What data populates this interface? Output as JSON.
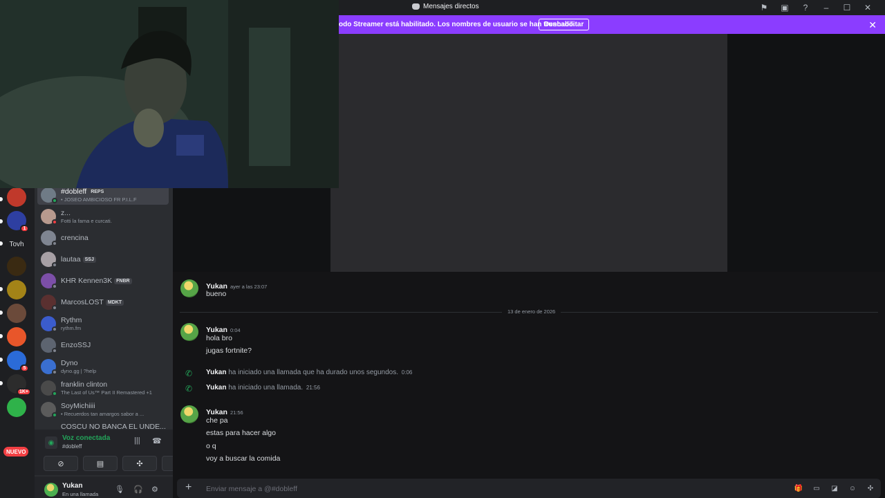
{
  "window": {
    "title": "Mensajes directos"
  },
  "banner": {
    "text": "odo Streamer está habilitado. Los nombres de usuario se han truncado.",
    "button": "Deshabilitar",
    "color": "#8b3dff"
  },
  "rail": {
    "servers": [
      {
        "label": "",
        "color": "#c0392b"
      },
      {
        "label": "",
        "color": "#2e3fa1",
        "badge": "1"
      },
      {
        "label": "Tovh",
        "color": "#1e1f22"
      },
      {
        "label": "",
        "color": "#3a2a12"
      },
      {
        "label": "",
        "color": "#a38317"
      },
      {
        "label": "",
        "color": "#6b4a3a"
      },
      {
        "label": "",
        "color": "#e8562a"
      },
      {
        "label": "",
        "color": "#2b6bd8",
        "badge": "5"
      },
      {
        "label": "",
        "color": "#2c2c2c",
        "badge": "1K+"
      },
      {
        "label": "",
        "color": "#2fb24a"
      }
    ],
    "nuevo": "NUEVO"
  },
  "dms": [
    {
      "name": "#dobleff",
      "tag": "REPS",
      "sub": "• JOSEO AMBICIOSO FR P.I.L.F",
      "status": "#23a55a",
      "active": true,
      "avatar": "#6f7b86"
    },
    {
      "name": "z...",
      "tag": "",
      "sub": "Fotti la fama e curcati.",
      "status": "#f23f43",
      "active": false,
      "avatar": "#b89a8e"
    },
    {
      "name": "crencina",
      "tag": "",
      "sub": "",
      "status": "#80848e",
      "active": false,
      "avatar": "#7f8591"
    },
    {
      "name": "lautaa",
      "tag": "SSJ",
      "sub": "",
      "status": "#80848e",
      "active": false,
      "avatar": "#a7a0a5"
    },
    {
      "name": "KHR Kennen3K",
      "tag": "FNBR",
      "sub": "",
      "status": "#80848e",
      "active": false,
      "avatar": "#7c4fa8"
    },
    {
      "name": "MarcosLOST",
      "tag": "MDKT",
      "sub": "",
      "status": "#80848e",
      "active": false,
      "avatar": "#5a3030"
    },
    {
      "name": "Rythm",
      "tag": "",
      "sub": "rythm.fm",
      "status": "#80848e",
      "active": false,
      "avatar": "#3b5ccc"
    },
    {
      "name": "EnzoSSJ",
      "tag": "",
      "sub": "",
      "status": "#80848e",
      "active": false,
      "avatar": "#5d6470"
    },
    {
      "name": "Dyno",
      "tag": "",
      "sub": "dyno.gg | ?help",
      "status": "#80848e",
      "active": false,
      "avatar": "#3a6fd0"
    },
    {
      "name": "franklin clinton",
      "tag": "",
      "sub": "The Last of Us™ Part II Remastered +1",
      "status": "#23a55a",
      "active": false,
      "avatar": "#4a4a4a"
    },
    {
      "name": "SoyMichiiii",
      "tag": "",
      "sub": "• Recuerdos tan amargos sabor a ...",
      "status": "#23a55a",
      "active": false,
      "avatar": "#5b5b5b"
    },
    {
      "name": "COSCU NO BANCA EL UNDE...",
      "tag": "",
      "sub": "",
      "status": "#80848e",
      "active": false,
      "avatar": "#333"
    }
  ],
  "voice": {
    "status": "Voz conectada",
    "channel": "#dobleff"
  },
  "user": {
    "name": "Yukan",
    "status": "En una llamada"
  },
  "chat": {
    "messages": [
      {
        "author": "Yukan",
        "time": "ayer a las 23:07",
        "lines": [
          "bueno"
        ]
      },
      {
        "author": "Yukan",
        "time": "0:04",
        "lines": [
          "hola bro",
          "jugas fortnite?"
        ]
      },
      {
        "author": "Yukan",
        "time": "21:56",
        "lines": [
          "che pa",
          "estas para hacer algo",
          "o q",
          "voy a buscar la comida"
        ]
      }
    ],
    "date_divider": "13 de enero de 2026",
    "calls": [
      {
        "author": "Yukan",
        "text": "ha iniciado una llamada que ha durado unos segundos.",
        "time": "0:06"
      },
      {
        "author": "Yukan",
        "text": "ha iniciado una llamada.",
        "time": "21:56"
      }
    ],
    "composer_placeholder": "Enviar mensaje a @#dobleff"
  }
}
